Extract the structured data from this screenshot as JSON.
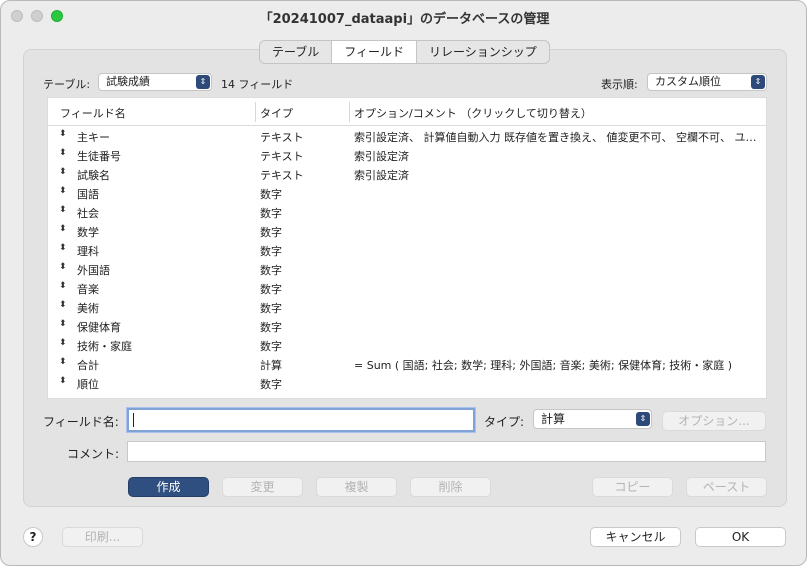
{
  "window": {
    "title": "「20241007_dataapi」のデータベースの管理"
  },
  "tabs": [
    {
      "label": "テーブル"
    },
    {
      "label": "フィールド"
    },
    {
      "label": "リレーションシップ"
    }
  ],
  "toolbar": {
    "table_label": "テーブル:",
    "table_value": "試験成績",
    "field_count": "14 フィールド",
    "sort_label": "表示順:",
    "sort_value": "カスタム順位"
  },
  "table": {
    "headers": [
      "フィールド名",
      "タイプ",
      "オプション/コメント （クリックして切り替え）"
    ],
    "rows": [
      {
        "name": "主キー",
        "type": "テキスト",
        "options": "索引設定済、 計算値自動入力  既存値を置き換え、 値変更不可、 空欄不可、 ユニーク…"
      },
      {
        "name": "生徒番号",
        "type": "テキスト",
        "options": "索引設定済"
      },
      {
        "name": "試験名",
        "type": "テキスト",
        "options": "索引設定済"
      },
      {
        "name": "国語",
        "type": "数字",
        "options": ""
      },
      {
        "name": "社会",
        "type": "数字",
        "options": ""
      },
      {
        "name": "数学",
        "type": "数字",
        "options": ""
      },
      {
        "name": "理科",
        "type": "数字",
        "options": ""
      },
      {
        "name": "外国語",
        "type": "数字",
        "options": ""
      },
      {
        "name": "音楽",
        "type": "数字",
        "options": ""
      },
      {
        "name": "美術",
        "type": "数字",
        "options": ""
      },
      {
        "name": "保健体育",
        "type": "数字",
        "options": ""
      },
      {
        "name": "技術・家庭",
        "type": "数字",
        "options": ""
      },
      {
        "name": "合計",
        "type": "計算",
        "options": "= Sum ( 国語; 社会; 数学; 理科; 外国語; 音楽; 美術; 保健体育; 技術・家庭 )"
      },
      {
        "name": "順位",
        "type": "数字",
        "options": ""
      }
    ]
  },
  "form": {
    "field_name_label": "フィールド名:",
    "field_name_value": "",
    "type_label": "タイプ:",
    "type_value": "計算",
    "options_button": "オプション...",
    "comment_label": "コメント:",
    "comment_value": ""
  },
  "actions": {
    "create": "作成",
    "change": "変更",
    "duplicate": "複製",
    "delete": "削除",
    "copy": "コピー",
    "paste": "ペースト"
  },
  "footer": {
    "help": "?",
    "print": "印刷...",
    "cancel": "キャンセル",
    "ok": "OK"
  },
  "icons": {
    "row_handle": "drag-handle-icon",
    "popup_arrow": "updown-chevron-icon"
  },
  "colors": {
    "primary_button": "#2f4f80",
    "focus_ring": "#7fa2d9",
    "maximize": "#2bc840"
  }
}
